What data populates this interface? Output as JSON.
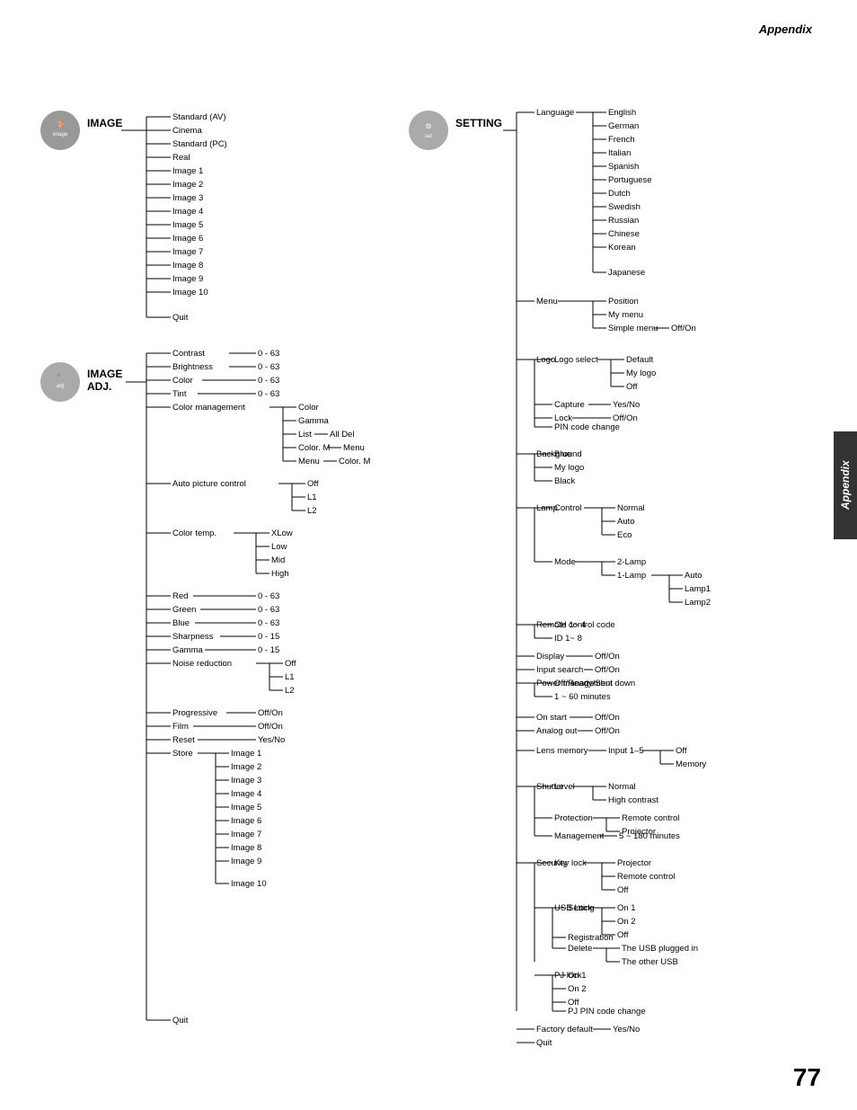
{
  "page": {
    "title": "Appendix",
    "page_number": "77"
  },
  "appendix_tab": "Appendix",
  "left_section": {
    "image_section": {
      "label": "IMAGE",
      "items": [
        "Standard (AV)",
        "Cinema",
        "Standard (PC)",
        "Real",
        "Image 1",
        "Image 2",
        "Image 3",
        "Image 4",
        "Image 5",
        "Image 6",
        "Image 7",
        "Image 8",
        "Image 9",
        "Image 10",
        "Quit"
      ]
    },
    "image_adj_section": {
      "label": "IMAGE ADJ.",
      "items": [
        {
          "name": "Contrast",
          "value": "0 - 63"
        },
        {
          "name": "Brightness",
          "value": "0 - 63"
        },
        {
          "name": "Color",
          "value": "0 - 63"
        },
        {
          "name": "Tint",
          "value": "0 - 63"
        },
        {
          "name": "Color management",
          "sub": [
            "Color",
            "Gamma",
            "List",
            "Color. M",
            "Menu"
          ]
        },
        {
          "name": "Auto picture control",
          "sub": [
            "Off",
            "L1",
            "L2"
          ]
        },
        {
          "name": "Color temp.",
          "sub": [
            "XLow",
            "Low",
            "Mid",
            "High"
          ]
        },
        {
          "name": "Red",
          "value": "0 - 63"
        },
        {
          "name": "Green",
          "value": "0 - 63"
        },
        {
          "name": "Blue",
          "value": "0 - 63"
        },
        {
          "name": "Sharpness",
          "value": "0 - 15"
        },
        {
          "name": "Gamma",
          "value": "0 - 15"
        },
        {
          "name": "Noise reduction",
          "sub": [
            "Off",
            "L1",
            "L2"
          ]
        },
        {
          "name": "Progressive",
          "value": "Off/On"
        },
        {
          "name": "Film",
          "value": "Off/On"
        },
        {
          "name": "Reset",
          "value": "Yes/No"
        },
        {
          "name": "Store",
          "sub": [
            "Image 1",
            "Image 2",
            "Image 3",
            "Image 4",
            "Image 5",
            "Image 6",
            "Image 7",
            "Image 8",
            "Image 9",
            "Image 10"
          ]
        },
        {
          "name": "Quit"
        }
      ],
      "color_management_sub": {
        "list_sub": [
          "All Del"
        ],
        "color_m_sub": [
          "Menu"
        ],
        "menu_sub": [
          "Color. M"
        ]
      }
    }
  },
  "right_section": {
    "setting_section": {
      "label": "SETTING",
      "language": {
        "label": "Language",
        "items": [
          "English",
          "German",
          "French",
          "Italian",
          "Spanish",
          "Portuguese",
          "Dutch",
          "Swedish",
          "Russian",
          "Chinese",
          "Korean",
          "Japanese"
        ]
      },
      "menu": {
        "label": "Menu",
        "items": [
          "Position",
          "My menu",
          "Simple menu"
        ],
        "simple_menu_value": "Off/On"
      },
      "logo": {
        "label": "Logo",
        "logo_select": {
          "label": "Logo select",
          "items": [
            "Default",
            "My logo",
            "Off"
          ]
        },
        "capture": {
          "label": "Capture",
          "value": "Yes/No"
        },
        "lock": {
          "label": "Lock",
          "value": "Off/On"
        },
        "pin_code_change": "PIN code change"
      },
      "background": {
        "label": "Background",
        "items": [
          "Blue",
          "My logo",
          "Black"
        ]
      },
      "lamp": {
        "label": "Lamp",
        "control": {
          "label": "Control",
          "items": [
            "Normal",
            "Auto",
            "Eco"
          ]
        },
        "mode": {
          "label": "Mode",
          "items": [
            "2-Lamp",
            "1-Lamp"
          ],
          "one_lamp_sub": [
            "Auto",
            "Lamp1",
            "Lamp2"
          ]
        }
      },
      "remote_control_code": {
        "label": "Remote control code",
        "items": [
          "CH 1~ 4",
          "ID 1~ 8"
        ]
      },
      "display": {
        "label": "Display",
        "value": "Off/On"
      },
      "input_search": {
        "label": "Input search",
        "value": "Off/On"
      },
      "power_management": {
        "label": "Power management",
        "items": [
          "Off/Ready/Shut down",
          "1 ~ 60 minutes"
        ]
      },
      "on_start": {
        "label": "On start",
        "value": "Off/On"
      },
      "analog_out": {
        "label": "Analog out",
        "value": "Off/On"
      },
      "lens_memory": {
        "label": "Lens memory",
        "input": {
          "label": "Input 1–5",
          "items": [
            "Off",
            "Memory"
          ]
        }
      },
      "shutter": {
        "label": "Shutter",
        "level": {
          "label": "Level",
          "items": [
            "Normal",
            "High contrast"
          ]
        },
        "protection": {
          "label": "Protection",
          "items": [
            "Remote control",
            "Projector"
          ]
        },
        "management": {
          "label": "Management",
          "value": "5 ~ 180 minutes"
        }
      },
      "security": {
        "label": "Security",
        "key_lock": {
          "label": "Key lock",
          "items": [
            "Projector",
            "Remote control",
            "Off"
          ]
        },
        "usb_lock": {
          "label": "USB Lock",
          "setting": {
            "label": "Setting",
            "items": [
              "On 1",
              "On 2",
              "Off"
            ]
          },
          "registration": "Registration",
          "delete": {
            "label": "Delete",
            "items": [
              "The USB plugged in",
              "The other USB"
            ]
          }
        },
        "pj_lock": {
          "label": "PJ lock",
          "items": [
            "On 1",
            "On 2",
            "Off"
          ],
          "pj_pin_code_change": "PJ PIN code change"
        }
      },
      "factory_default": {
        "label": "Factory default",
        "value": "Yes/No"
      },
      "quit": "Quit"
    }
  }
}
